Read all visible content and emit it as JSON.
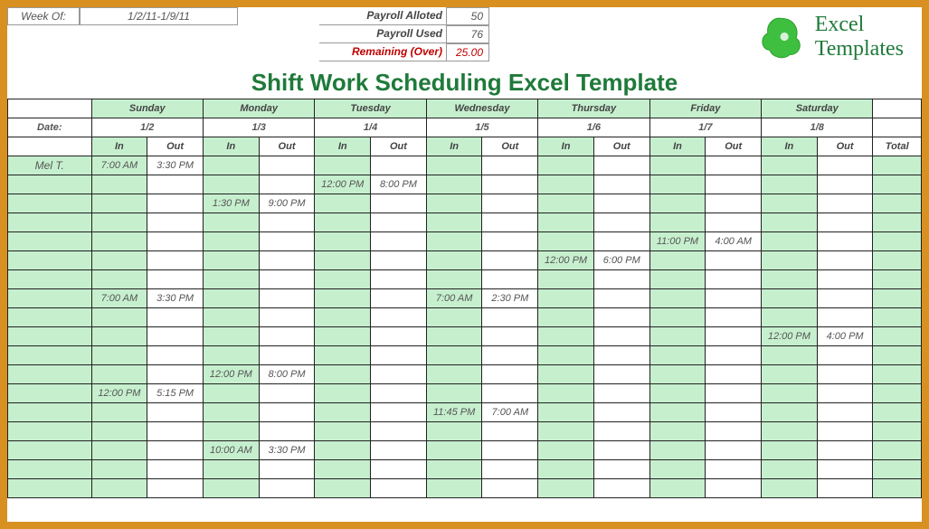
{
  "header": {
    "week_of_label": "Week Of:",
    "week_of_value": "1/2/11-1/9/11",
    "payroll_alloted_label": "Payroll Alloted",
    "payroll_alloted_value": "50",
    "payroll_used_label": "Payroll Used",
    "payroll_used_value": "76",
    "remaining_label": "Remaining (Over)",
    "remaining_value": "25.00"
  },
  "title": "Shift Work Scheduling Excel Template",
  "logo": {
    "line1": "Excel",
    "line2": "Templates"
  },
  "table": {
    "date_label": "Date:",
    "total_label": "Total",
    "in_label": "In",
    "out_label": "Out",
    "days": [
      {
        "name": "Sunday",
        "date": "1/2"
      },
      {
        "name": "Monday",
        "date": "1/3"
      },
      {
        "name": "Tuesday",
        "date": "1/4"
      },
      {
        "name": "Wednesday",
        "date": "1/5"
      },
      {
        "name": "Thursday",
        "date": "1/6"
      },
      {
        "name": "Friday",
        "date": "1/7"
      },
      {
        "name": "Saturday",
        "date": "1/8"
      }
    ],
    "employees": [
      "Mel T."
    ],
    "rows": [
      {
        "emp": "Mel T.",
        "cells": [
          "7:00 AM",
          "3:30 PM",
          "",
          "",
          "",
          "",
          "",
          "",
          "",
          "",
          "",
          "",
          "",
          ""
        ]
      },
      {
        "emp": "",
        "cells": [
          "",
          "",
          "",
          "",
          "12:00 PM",
          "8:00 PM",
          "",
          "",
          "",
          "",
          "",
          "",
          "",
          ""
        ]
      },
      {
        "emp": "",
        "cells": [
          "",
          "",
          "1:30 PM",
          "9:00 PM",
          "",
          "",
          "",
          "",
          "",
          "",
          "",
          "",
          "",
          ""
        ]
      },
      {
        "emp": "",
        "cells": [
          "",
          "",
          "",
          "",
          "",
          "",
          "",
          "",
          "",
          "",
          "",
          "",
          "",
          ""
        ]
      },
      {
        "emp": "",
        "cells": [
          "",
          "",
          "",
          "",
          "",
          "",
          "",
          "",
          "",
          "",
          "11:00 PM",
          "4:00 AM",
          "",
          ""
        ]
      },
      {
        "emp": "",
        "cells": [
          "",
          "",
          "",
          "",
          "",
          "",
          "",
          "",
          "12:00 PM",
          "6:00 PM",
          "",
          "",
          "",
          ""
        ]
      },
      {
        "emp": "",
        "cells": [
          "",
          "",
          "",
          "",
          "",
          "",
          "",
          "",
          "",
          "",
          "",
          "",
          "",
          ""
        ]
      },
      {
        "emp": "",
        "cells": [
          "7:00 AM",
          "3:30 PM",
          "",
          "",
          "",
          "",
          "7:00 AM",
          "2:30 PM",
          "",
          "",
          "",
          "",
          "",
          ""
        ]
      },
      {
        "emp": "",
        "cells": [
          "",
          "",
          "",
          "",
          "",
          "",
          "",
          "",
          "",
          "",
          "",
          "",
          "",
          ""
        ]
      },
      {
        "emp": "",
        "cells": [
          "",
          "",
          "",
          "",
          "",
          "",
          "",
          "",
          "",
          "",
          "",
          "",
          "12:00 PM",
          "4:00 PM"
        ]
      },
      {
        "emp": "",
        "cells": [
          "",
          "",
          "",
          "",
          "",
          "",
          "",
          "",
          "",
          "",
          "",
          "",
          "",
          ""
        ]
      },
      {
        "emp": "",
        "cells": [
          "",
          "",
          "12:00 PM",
          "8:00 PM",
          "",
          "",
          "",
          "",
          "",
          "",
          "",
          "",
          "",
          ""
        ]
      },
      {
        "emp": "",
        "cells": [
          "12:00 PM",
          "5:15 PM",
          "",
          "",
          "",
          "",
          "",
          "",
          "",
          "",
          "",
          "",
          "",
          ""
        ]
      },
      {
        "emp": "",
        "cells": [
          "",
          "",
          "",
          "",
          "",
          "",
          "11:45 PM",
          "7:00 AM",
          "",
          "",
          "",
          "",
          "",
          ""
        ]
      },
      {
        "emp": "",
        "cells": [
          "",
          "",
          "",
          "",
          "",
          "",
          "",
          "",
          "",
          "",
          "",
          "",
          "",
          ""
        ]
      },
      {
        "emp": "",
        "cells": [
          "",
          "",
          "10:00 AM",
          "3:30 PM",
          "",
          "",
          "",
          "",
          "",
          "",
          "",
          "",
          "",
          ""
        ]
      },
      {
        "emp": "",
        "cells": [
          "",
          "",
          "",
          "",
          "",
          "",
          "",
          "",
          "",
          "",
          "",
          "",
          "",
          ""
        ]
      },
      {
        "emp": "",
        "cells": [
          "",
          "",
          "",
          "",
          "",
          "",
          "",
          "",
          "",
          "",
          "",
          "",
          "",
          ""
        ]
      }
    ]
  }
}
